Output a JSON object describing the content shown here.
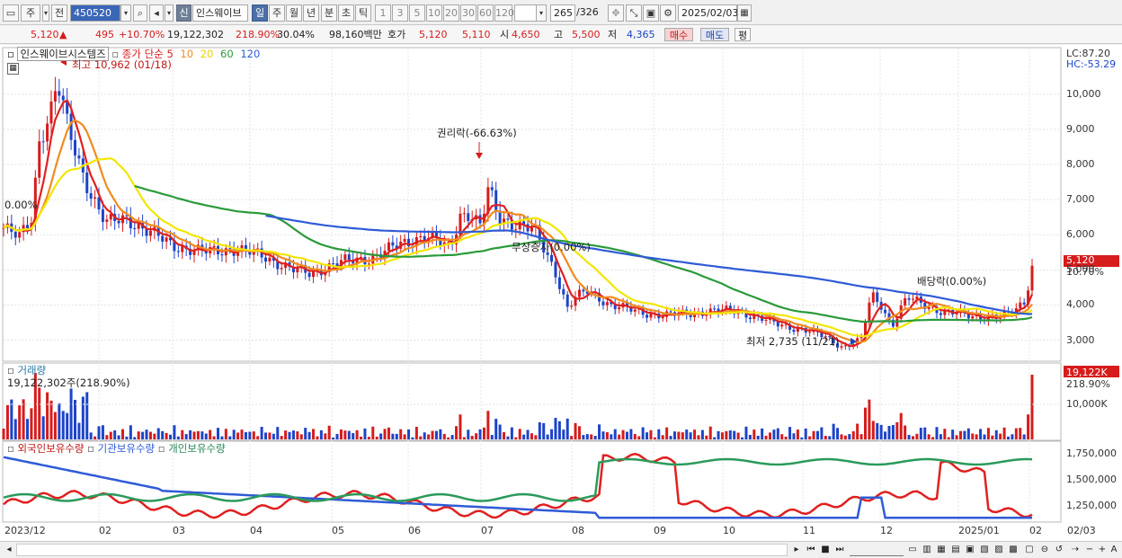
{
  "toolbar": {
    "period": "주",
    "prev": "전",
    "code": "450520",
    "badge": "신",
    "name": "인스웨이브",
    "tabs": [
      "일",
      "주",
      "월",
      "년",
      "분",
      "초",
      "틱"
    ],
    "active_tab": "일",
    "intervals": [
      "1",
      "3",
      "5",
      "10",
      "20",
      "30",
      "60",
      "120"
    ],
    "count": "265",
    "total": "/326",
    "date": "2025/02/03"
  },
  "info": {
    "price": "5,120",
    "arrow": "▲",
    "change": "495",
    "change_pct": "+10.70%",
    "volume": "19,122,302",
    "volume_pct": "218.90%",
    "turnover": "30.04%",
    "amount": "98,160백만",
    "quote_label": "호가",
    "quote1": "5,120",
    "quote2": "5,110",
    "open_label": "시",
    "open": "4,650",
    "high_label": "고",
    "high": "5,500",
    "low_label": "저",
    "low": "4,365",
    "buy": "매수",
    "sell": "매도",
    "eval": "평"
  },
  "chart_data": [
    {
      "type": "candlestick",
      "panel": "price",
      "title": "인스웨이브시스템즈",
      "ma_label": "종가 단순",
      "ma_periods": [
        {
          "name": "5",
          "color": "#e02020"
        },
        {
          "name": "10",
          "color": "#f08c1e"
        },
        {
          "name": "20",
          "color": "#f2e600"
        },
        {
          "name": "60",
          "color": "#2a9a3a"
        },
        {
          "name": "120",
          "color": "#2f5bd6"
        }
      ],
      "yticks": [
        "10,000",
        "9,000",
        "8,000",
        "7,000",
        "6,000",
        "5,000",
        "4,000",
        "3,000"
      ],
      "ylim": [
        2400,
        11300
      ],
      "lc": "LC:87.20",
      "hc": "HC:-53.29",
      "last_price": "5,120",
      "last_pct": "10.70%",
      "annotations": {
        "high": "최고 10,962 (01/18)",
        "rights": "권리락(-66.63%)",
        "bonus": "무상증자(0.00%)",
        "dividend": "배당락(0.00%)",
        "low": "최저 2,735 (11/21)",
        "left": "0.00%"
      },
      "price_series": [
        {
          "d": "2023-12-28",
          "v": 6200
        },
        {
          "d": "2024-01-03",
          "v": 5900
        },
        {
          "d": "2024-01-08",
          "v": 6500
        },
        {
          "d": "2024-01-11",
          "v": 8700
        },
        {
          "d": "2024-01-16",
          "v": 9600
        },
        {
          "d": "2024-01-18",
          "v": 10300
        },
        {
          "d": "2024-01-22",
          "v": 9100
        },
        {
          "d": "2024-01-26",
          "v": 8200
        },
        {
          "d": "2024-01-31",
          "v": 7200
        },
        {
          "d": "2024-02-06",
          "v": 6300
        },
        {
          "d": "2024-02-14",
          "v": 6500
        },
        {
          "d": "2024-02-22",
          "v": 6100
        },
        {
          "d": "2024-03-04",
          "v": 5700
        },
        {
          "d": "2024-03-14",
          "v": 5500
        },
        {
          "d": "2024-03-26",
          "v": 5600
        },
        {
          "d": "2024-04-08",
          "v": 5400
        },
        {
          "d": "2024-04-19",
          "v": 5000
        },
        {
          "d": "2024-04-26",
          "v": 4900
        },
        {
          "d": "2024-05-07",
          "v": 5200
        },
        {
          "d": "2024-05-20",
          "v": 5350
        },
        {
          "d": "2024-05-31",
          "v": 5700
        },
        {
          "d": "2024-06-10",
          "v": 6000
        },
        {
          "d": "2024-06-20",
          "v": 5600
        },
        {
          "d": "2024-06-24",
          "v": 6600
        },
        {
          "d": "2024-06-28",
          "v": 6600
        },
        {
          "d": "2024-07-02",
          "v": 6200
        },
        {
          "d": "2024-07-05",
          "v": 7300
        },
        {
          "d": "2024-07-09",
          "v": 6500
        },
        {
          "d": "2024-07-16",
          "v": 6300
        },
        {
          "d": "2024-07-23",
          "v": 6100
        },
        {
          "d": "2024-07-26",
          "v": 5700
        },
        {
          "d": "2024-07-31",
          "v": 5000
        },
        {
          "d": "2024-08-05",
          "v": 3900
        },
        {
          "d": "2024-08-08",
          "v": 4200
        },
        {
          "d": "2024-08-13",
          "v": 4400
        },
        {
          "d": "2024-08-22",
          "v": 4000
        },
        {
          "d": "2024-09-02",
          "v": 3800
        },
        {
          "d": "2024-09-12",
          "v": 3700
        },
        {
          "d": "2024-09-26",
          "v": 3800
        },
        {
          "d": "2024-10-10",
          "v": 3850
        },
        {
          "d": "2024-10-24",
          "v": 3500
        },
        {
          "d": "2024-11-05",
          "v": 3300
        },
        {
          "d": "2024-11-14",
          "v": 3100
        },
        {
          "d": "2024-11-21",
          "v": 2800
        },
        {
          "d": "2024-11-28",
          "v": 3000
        },
        {
          "d": "2024-12-02",
          "v": 4300
        },
        {
          "d": "2024-12-06",
          "v": 4000
        },
        {
          "d": "2024-12-10",
          "v": 3400
        },
        {
          "d": "2024-12-16",
          "v": 4200
        },
        {
          "d": "2024-12-20",
          "v": 4100
        },
        {
          "d": "2024-12-30",
          "v": 3800
        },
        {
          "d": "2025-01-10",
          "v": 3700
        },
        {
          "d": "2025-01-20",
          "v": 3650
        },
        {
          "d": "2025-01-24",
          "v": 3700
        },
        {
          "d": "2025-01-31",
          "v": 4100
        },
        {
          "d": "2025-02-03",
          "v": 5120
        }
      ]
    },
    {
      "type": "bar",
      "panel": "volume",
      "title": "거래량",
      "value_label": "19,122,302주(218.90%)",
      "ytick": "10,000K",
      "last_value": "19,122K",
      "last_pct": "218.90%"
    },
    {
      "type": "line",
      "panel": "holdings",
      "series": [
        {
          "name": "외국인보유수량",
          "color": "#e02020"
        },
        {
          "name": "기관보유수량",
          "color": "#2f5bd6"
        },
        {
          "name": "개인보유수량",
          "color": "#2a9a5a"
        }
      ],
      "yticks": [
        "1,750,000",
        "1,500,000",
        "1,250,000"
      ]
    }
  ],
  "xaxis": {
    "labels": [
      "2023/12",
      "02",
      "03",
      "04",
      "05",
      "06",
      "07",
      "08",
      "09",
      "10",
      "11",
      "12",
      "2025/01",
      "02",
      "02/03"
    ]
  }
}
